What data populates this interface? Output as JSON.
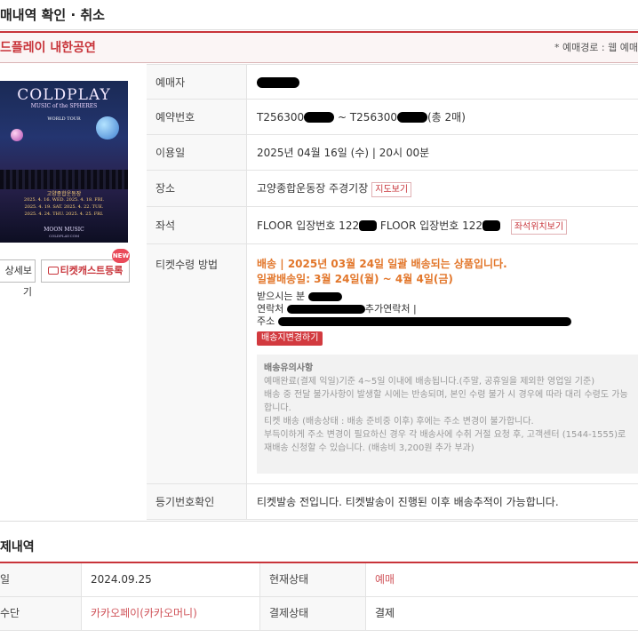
{
  "page": {
    "title": "매내역 확인 · 취소",
    "show_title": "드플레이 내한공연",
    "route_label": "* 예매경로 : 웹 예매"
  },
  "poster": {
    "headline": "COLDPLAY",
    "subtitle": "MUSIC of the SPHERES",
    "tour": "WORLD TOUR",
    "venue": "고양종합운동장",
    "dates": [
      "2025. 4. 16. WED.  2025. 4. 18. FRI.",
      "2025. 4. 19. SAT.  2025. 4. 22. TUE.",
      "2025. 4. 24. THU.  2025. 4. 25. FRI."
    ],
    "moon": "MOON MUSIC",
    "site": "COLDPLAY.COM"
  },
  "buttons": {
    "detail": "상세보기",
    "cast": "티켓캐스트등록",
    "new_badge": "NEW",
    "map": "지도보기",
    "seat_map": "좌석위치보기",
    "change_address": "배송지변경하기"
  },
  "info": {
    "booker_label": "예매자",
    "booking_no_label": "예약번호",
    "booking_no_prefix1": "T256300",
    "booking_no_sep": "~ T256300",
    "booking_no_total": "(총 2매)",
    "date_label": "이용일",
    "date_value": "2025년 04월 16일 (수) | 20시 00분",
    "place_label": "장소",
    "place_value": "고양종합운동장 주경기장",
    "seat_label": "좌석",
    "seat_value_1": "FLOOR 입장번호 122",
    "seat_value_2": "FLOOR 입장번호 122",
    "ticket_method_label": "티켓수령 방법",
    "ship_line1": "배송 | 2025년 03월 24일 일괄 배송되는 상품입니다.",
    "ship_line2": "일괄배송일: 3월 24일(월) ~ 4월 4일(금)",
    "recipient_label": "받으시는 분",
    "contact_label": "연락처",
    "extra_contact_label": "추가연락처 |",
    "address_label": "주소",
    "notice_title": "배송유의사항",
    "notice_lines": [
      "예매완료(결제 익일)기준 4~5일 이내에 배송됩니다.(주말, 공휴일을 제외한 영업일 기준)",
      "배송 중 전달 불가사항이 발생할 시에는 반송되며, 본인 수령 불가 시 경우에 따라 대리 수령도 가능합니다.",
      "티켓 배송 (배송상태 : 배송 준비중 이후) 후에는 주소 변경이 불가합니다.",
      "부득이하게 주소 변경이 필요하신 경우 각 배송사에 수취 거절 요청 후, 고객센터 (1544-1555)로 재배송 신청할 수 있습니다. (배송비 3,200원 추가 부과)"
    ],
    "registered_label": "등기번호확인",
    "registered_value": "티켓발송 전입니다. 티켓발송이 진행된 이후 배송추적이 가능합니다."
  },
  "payment": {
    "title": "제내역",
    "rows": [
      {
        "k1": "일",
        "v1": "2024.09.25",
        "k2": "현재상태",
        "v2": "예매"
      },
      {
        "k1": "수단",
        "v1": "카카오페이(카카오머니)",
        "k2": "결제상태",
        "v2": "결제"
      }
    ]
  },
  "colors": {
    "accent": "#c8343a",
    "ship": "#e2762a",
    "status": "#d0545a",
    "pay_method": "#d0545a"
  }
}
